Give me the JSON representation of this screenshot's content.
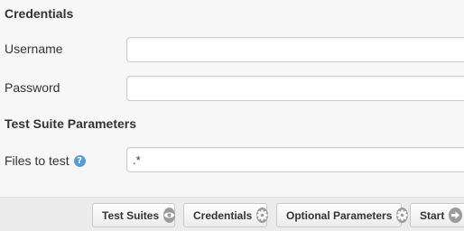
{
  "sections": {
    "credentials_title": "Credentials",
    "params_title": "Test Suite Parameters"
  },
  "fields": {
    "username_label": "Username",
    "username_value": "",
    "password_label": "Password",
    "password_value": "",
    "files_label": "Files to test",
    "files_value": ".*",
    "help_glyph": "?"
  },
  "footer": {
    "test_suites_label": "Test Suites",
    "credentials_label": "Credentials",
    "optional_params_label": "Optional Parameters",
    "start_label": "Start"
  },
  "icons": {
    "test_suites": "eye-icon",
    "credentials": "gear-icon",
    "optional_params": "gear-icon",
    "start": "arrow-right-icon"
  },
  "colors": {
    "help": "#5b9bd5",
    "button_icon": "#9b9b9b"
  }
}
